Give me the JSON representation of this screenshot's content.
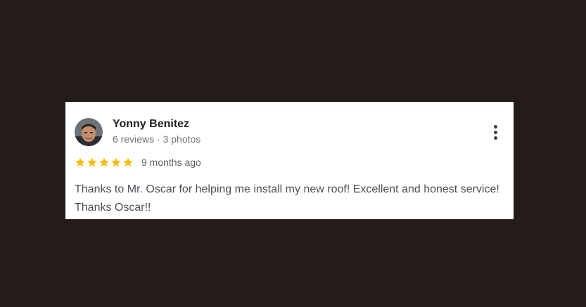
{
  "review": {
    "author": {
      "name": "Yonny Benitez",
      "meta": "6 reviews · 3 photos",
      "avatar_icon": "profile-photo"
    },
    "rating": {
      "stars": 5,
      "max": 5,
      "star_color": "#fbbc04"
    },
    "date": "9 months ago",
    "text": "Thanks to Mr. Oscar for helping me install my new roof! Excellent and honest service! Thanks Oscar!!",
    "more_icon": "more-vert-icon"
  }
}
